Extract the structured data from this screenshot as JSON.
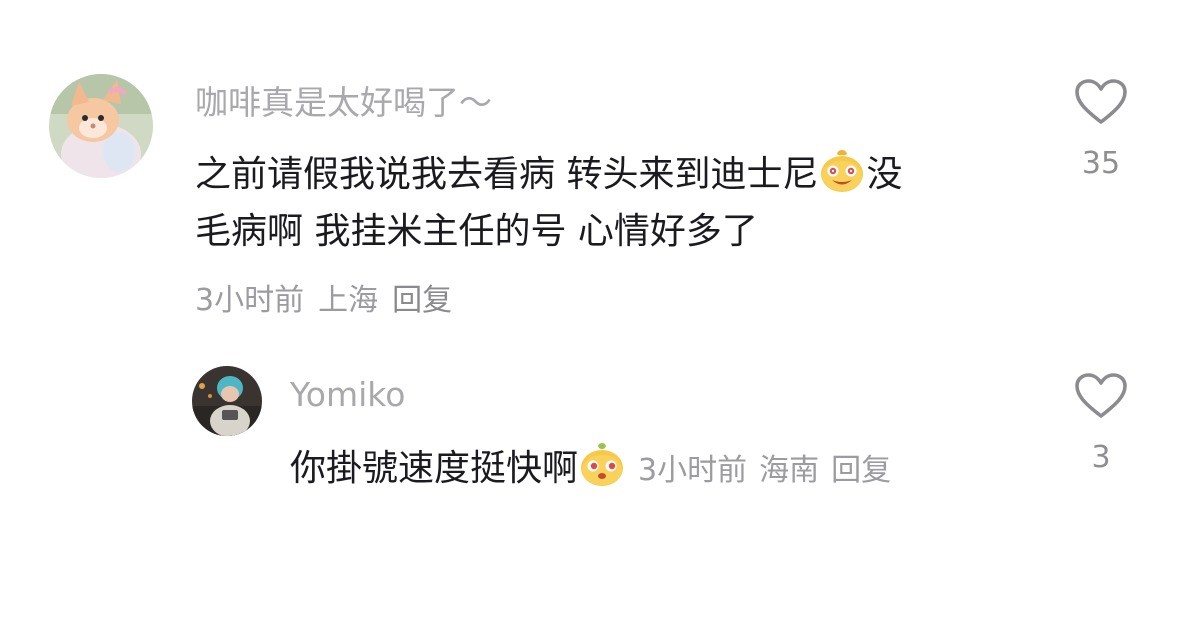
{
  "comments": [
    {
      "username": "咖啡真是太好喝了～",
      "text_line1_pre": "之前请假我说我去看病 转头来到迪士尼",
      "text_line1_post": "没",
      "text_line2": "毛病啊 我挂米主任的号 心情好多了",
      "emoji": "smiling-mango-emoji",
      "time": "3小时前",
      "location": "上海",
      "reply_label": "回复",
      "likes": "35"
    }
  ],
  "replies": [
    {
      "username": "Yomiko",
      "text": "你掛號速度挺快啊",
      "emoji": "curious-mango-emoji",
      "time": "3小时前",
      "location": "海南",
      "reply_label": "回复",
      "likes": "3"
    }
  ],
  "colors": {
    "username": "#a9a9ad",
    "content": "#1b1b1f",
    "meta": "#9b9ba0",
    "emoji_body": "#f7c948"
  }
}
